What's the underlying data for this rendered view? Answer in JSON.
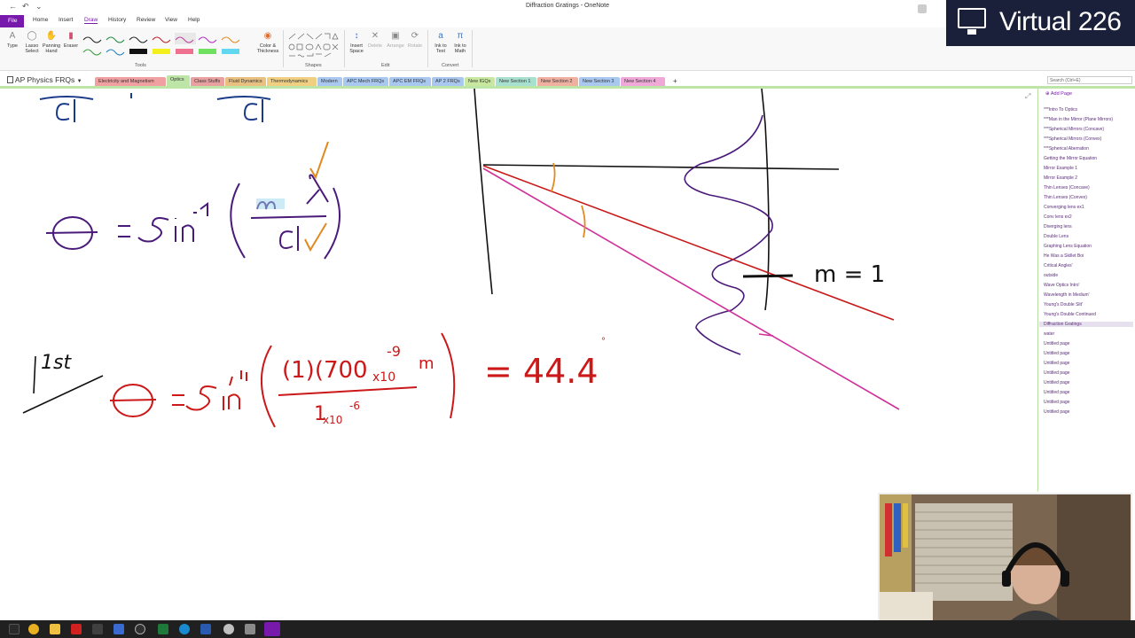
{
  "window": {
    "title": "Diffraction Gratings - OneNote"
  },
  "menu": {
    "tabs": [
      "File",
      "Home",
      "Insert",
      "Draw",
      "History",
      "Review",
      "View",
      "Help"
    ],
    "active": "Draw"
  },
  "ribbon": {
    "type_label": "Type",
    "lasso_label": "Lasso\nSelect",
    "panning_label": "Panning\nHand",
    "eraser_label": "Eraser",
    "color_thickness_label": "Color &\nThickness",
    "tools_group": "Tools",
    "shapes_group": "Shapes",
    "insert_space_label": "Insert\nSpace",
    "delete_label": "Delete",
    "arrange_label": "Arrange",
    "rotate_label": "Rotate",
    "edit_group": "Edit",
    "ink_to_text_label": "Ink to\nText",
    "ink_to_math_label": "Ink to\nMath",
    "convert_group": "Convert"
  },
  "overlay": {
    "brand": "Virtual 226"
  },
  "notebook": {
    "name": "AP Physics FRQs"
  },
  "sections": [
    {
      "label": "Electricity and Magnetism",
      "color": "#f0a0a0"
    },
    {
      "label": "Optics",
      "color": "#bde5a8"
    },
    {
      "label": "Class Stuffs",
      "color": "#e8a0a0"
    },
    {
      "label": "Fluid Dynamics",
      "color": "#e8c080"
    },
    {
      "label": "Thermodynamics",
      "color": "#f0d080"
    },
    {
      "label": "Modern",
      "color": "#a8c8f0"
    },
    {
      "label": "APC Mech FRQs",
      "color": "#a8c8f0"
    },
    {
      "label": "APC EM FRQs",
      "color": "#a8c8f0"
    },
    {
      "label": "AP 2 FRQs",
      "color": "#a8c8f0"
    },
    {
      "label": "New IGQs",
      "color": "#c8e8a0"
    },
    {
      "label": "New Section 1",
      "color": "#a8e0d0"
    },
    {
      "label": "New Section 2",
      "color": "#f0b0a0"
    },
    {
      "label": "New Section 3",
      "color": "#a8c8f0"
    },
    {
      "label": "New Section 4",
      "color": "#f0a8d8"
    }
  ],
  "search": {
    "placeholder": "Search (Ctrl+E)"
  },
  "pages": {
    "add_label": "Add Page",
    "items": [
      "***Intro To Optics",
      "***Man in the Mirror (Plane Mirrors)",
      "***Spherical Mirrors (Concave)",
      "***Spherical Mirrors (Convex)",
      "***Spherical Aberration",
      "Getting the Mirror Equation",
      "Mirror Example 1",
      "Mirror Example 2",
      "Thin Lenses (Concave)",
      "Thin Lenses (Convex)",
      "Converging lens ex1",
      "Conv lens ex2",
      "Diverging lens",
      "Double Lens",
      "Graphing Lens Equation",
      "He Was a Skillet Boi",
      "Critical Angles'",
      "outside",
      "Wave Optics Intro'",
      "Wavelength in Medium'",
      "Young's Double Slit'",
      "Young's Double Continued",
      "Diffraction Gratings",
      "water",
      "Untitled page",
      "Untitled page",
      "Untitled page",
      "Untitled page",
      "Untitled page",
      "Untitled page",
      "Untitled page",
      "Untitled page"
    ],
    "selected_index": 22
  },
  "ink": {
    "eq1": "θ = sin⁻¹ ( mλ / d )",
    "eq1_theta": "θ",
    "eq1_eq": "=",
    "eq1_sin": "sin",
    "eq1_inv": "-1",
    "eq1_num": "m λ",
    "eq1_den": "d",
    "top_d1": "d",
    "top_d2": "d",
    "label_m": "m = 1",
    "order_label": "1st",
    "eq2_theta": "θ",
    "eq2_eq": "=",
    "eq2_sin": "sin",
    "eq2_inv": "-1",
    "eq2_num": "(1)(700",
    "eq2_x10": "x10",
    "eq2_exp9": "-9",
    "eq2_m": "m",
    "eq2_den": "1",
    "eq2_den_x10": "x10",
    "eq2_exp6": "-6",
    "result": "= 44.4",
    "degree": "°"
  }
}
